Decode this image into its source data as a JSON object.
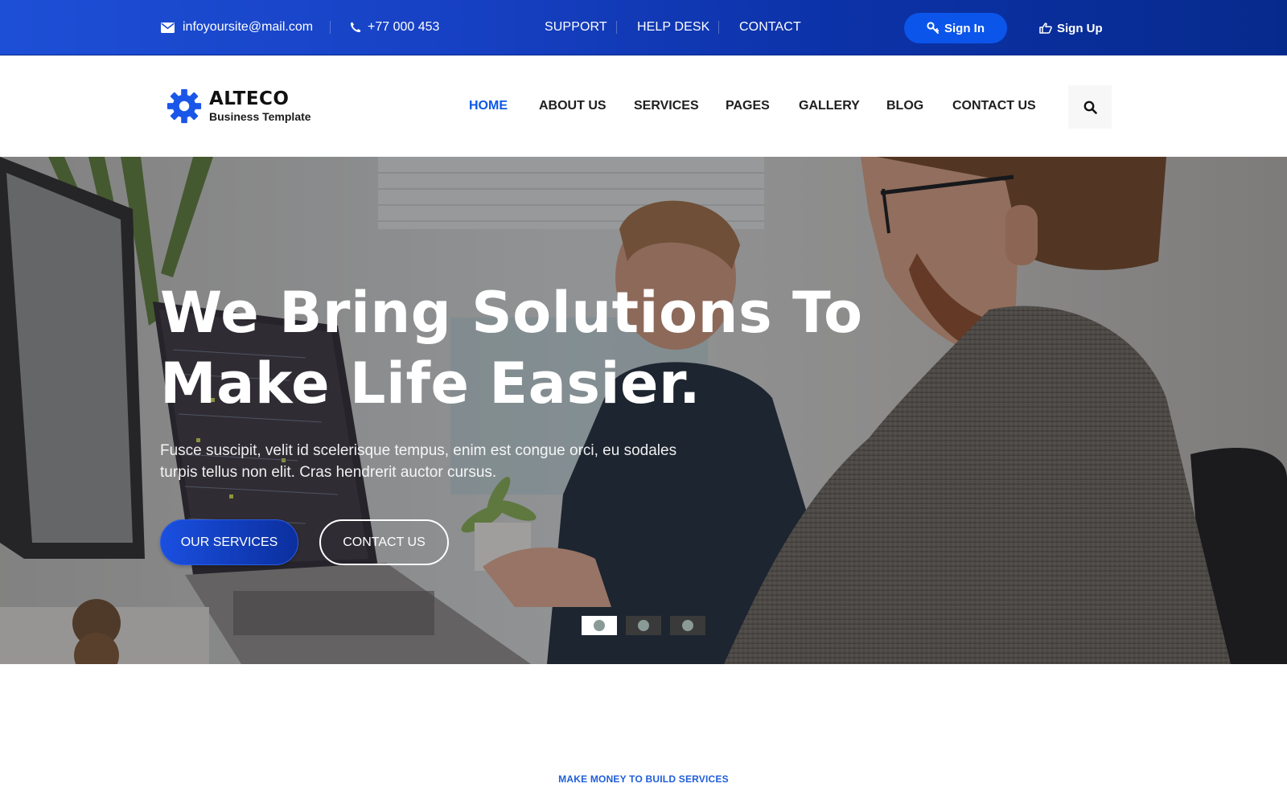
{
  "topbar": {
    "email": "infoyoursite@mail.com",
    "phone": "+77 000 453",
    "links": [
      {
        "label": "SUPPORT"
      },
      {
        "label": "HELP DESK"
      },
      {
        "label": "CONTACT"
      }
    ],
    "sign_in_label": "Sign In",
    "sign_up_label": "Sign Up",
    "icons": {
      "email": "envelope-icon",
      "phone": "phone-icon",
      "sign_in": "key-icon",
      "sign_up": "thumbs-up-icon"
    }
  },
  "header": {
    "logo": {
      "name": "ALTECO",
      "tagline": "Business Template",
      "icon": "gear-icon"
    },
    "nav": [
      {
        "label": "HOME",
        "active": true
      },
      {
        "label": "ABOUT US",
        "active": false
      },
      {
        "label": "SERVICES",
        "active": false
      },
      {
        "label": "PAGES",
        "active": false
      },
      {
        "label": "GALLERY",
        "active": false
      },
      {
        "label": "BLOG",
        "active": false
      },
      {
        "label": "CONTACT US",
        "active": false
      }
    ],
    "search_icon": "search-icon"
  },
  "hero": {
    "title_line1": "We Bring Solutions To",
    "title_line2": "Make Life Easier.",
    "subtitle": "Fusce suscipit, velit id scelerisque tempus, enim est congue orci, eu sodales turpis tellus non elit. Cras hendrerit auctor cursus.",
    "primary_button": "OUR SERVICES",
    "secondary_button": "CONTACT US",
    "slides": {
      "count": 3,
      "active_index": 0
    }
  },
  "section": {
    "kicker": "MAKE MONEY TO BUILD SERVICES"
  },
  "colors": {
    "brand_blue": "#0b57e6",
    "topbar_start": "#1d4fd6",
    "topbar_end": "#062a8c",
    "sign_in_bg": "#0b55ea",
    "kicker": "#1f5ed9"
  }
}
